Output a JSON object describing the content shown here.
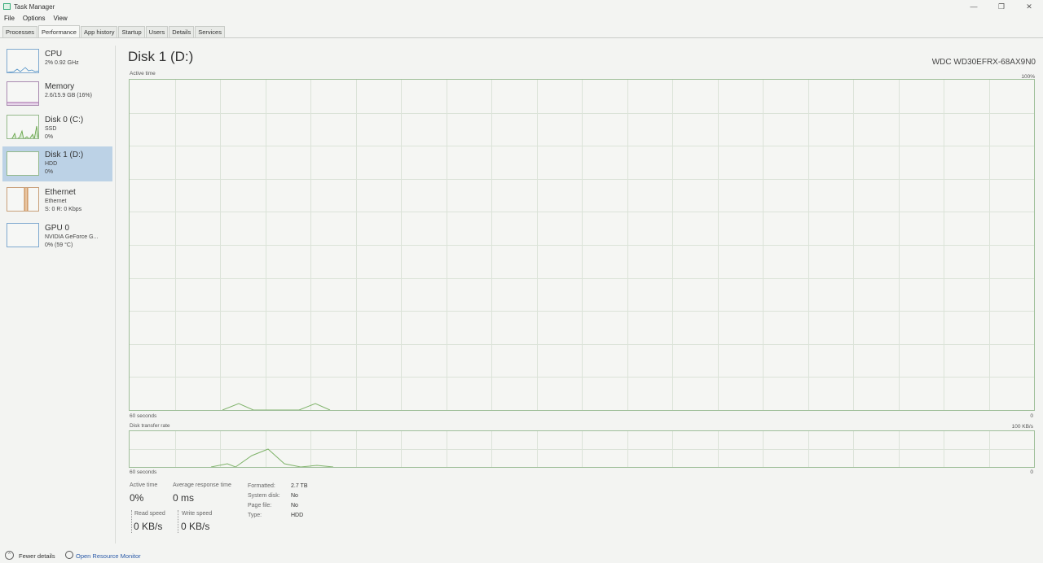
{
  "window": {
    "title": "Task Manager",
    "controls": {
      "minimize": "—",
      "restore": "❐",
      "close": "✕"
    }
  },
  "menu": [
    "File",
    "Options",
    "View"
  ],
  "tabs": [
    "Processes",
    "Performance",
    "App history",
    "Startup",
    "Users",
    "Details",
    "Services"
  ],
  "active_tab": "Performance",
  "sidebar": {
    "items": [
      {
        "title": "CPU",
        "sub1": "2% 0.92 GHz",
        "sub2": "",
        "color": "#4a8ec6"
      },
      {
        "title": "Memory",
        "sub1": "2.6/15.9 GB (16%)",
        "sub2": "",
        "color": "#8b3a8f"
      },
      {
        "title": "Disk 0 (C:)",
        "sub1": "SSD",
        "sub2": "0%",
        "color": "#5d9e3c"
      },
      {
        "title": "Disk 1 (D:)",
        "sub1": "HDD",
        "sub2": "0%",
        "color": "#5d9e3c"
      },
      {
        "title": "Ethernet",
        "sub1": "Ethernet",
        "sub2": "S: 0 R: 0 Kbps",
        "color": "#b5651d"
      },
      {
        "title": "GPU 0",
        "sub1": "NVIDIA GeForce G...",
        "sub2": "0% (59 °C)",
        "color": "#4a8ec6"
      }
    ],
    "selected": "Disk 1 (D:)"
  },
  "main": {
    "title": "Disk 1 (D:)",
    "model": "WDC WD30EFRX-68AX9N0",
    "active_time_graph": {
      "label": "Active time",
      "max": "100%",
      "left_caption": "60 seconds",
      "right_caption": "0"
    },
    "transfer_graph": {
      "label": "Disk transfer rate",
      "max": "100 KB/s",
      "left_caption": "60 seconds",
      "right_caption": "0"
    }
  },
  "stats": {
    "active_time_label": "Active time",
    "active_time_value": "0%",
    "response_label": "Average response time",
    "response_value": "0 ms",
    "read_label": "Read speed",
    "read_value": "0 KB/s",
    "write_label": "Write speed",
    "write_value": "0 KB/s"
  },
  "properties": [
    {
      "label": "Formatted:",
      "value": "2.7 TB"
    },
    {
      "label": "System disk:",
      "value": "No"
    },
    {
      "label": "Page file:",
      "value": "No"
    },
    {
      "label": "Type:",
      "value": "HDD"
    }
  ],
  "footer": {
    "fewer_details": "Fewer details",
    "open_monitor": "Open Resource Monitor"
  }
}
